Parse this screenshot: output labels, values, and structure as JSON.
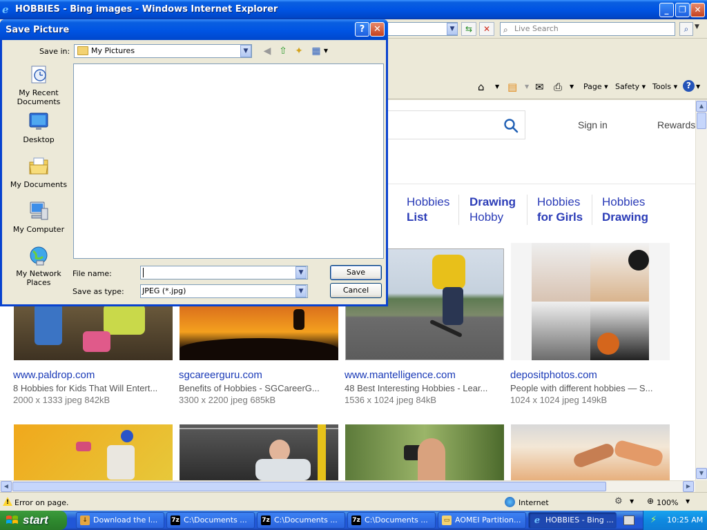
{
  "browser": {
    "title": "HOBBIES - Bing images - Windows Internet Explorer",
    "search_placeholder": "Live Search",
    "cmd": {
      "page": "Page",
      "safety": "Safety",
      "tools": "Tools"
    }
  },
  "bing": {
    "sign_in": "Sign in",
    "rewards": "Rewards",
    "chips": [
      {
        "line1": "Hobbies",
        "line2": "List",
        "bold": "line2"
      },
      {
        "line1": "Drawing",
        "line2": "Hobby",
        "bold": "line1"
      },
      {
        "line1": "Hobbies",
        "line2": "for Girls",
        "bold": "line2"
      },
      {
        "line1": "Hobbies",
        "line2": "Drawing",
        "bold": "line2"
      }
    ],
    "results": [
      {
        "site": "www.paldrop.com",
        "title": "8 Hobbies for Kids That Will Entert...",
        "meta": "2000 x 1333 jpeg 842kB"
      },
      {
        "site": "sgcareerguru.com",
        "title": "Benefits of Hobbies - SGCareerG...",
        "meta": "3300 x 2200 jpeg 685kB"
      },
      {
        "site": "www.mantelligence.com",
        "title": "48 Best Interesting Hobbies - Lear...",
        "meta": "1536 x 1024 jpeg 84kB"
      },
      {
        "site": "depositphotos.com",
        "title": "People with different hobbies — S...",
        "meta": "1024 x 1024 jpeg 149kB"
      }
    ]
  },
  "dialog": {
    "title": "Save Picture",
    "help": "?",
    "close": "✕",
    "save_in_label": "Save in:",
    "save_in_value": "My Pictures",
    "places": [
      "My Recent Documents",
      "Desktop",
      "My Documents",
      "My Computer",
      "My Network Places"
    ],
    "file_name_label": "File name:",
    "file_name_value": "",
    "save_as_label": "Save as type:",
    "save_as_value": "JPEG (*.jpg)",
    "save_button": "Save",
    "cancel_button": "Cancel"
  },
  "statusbar": {
    "message": "Error on page.",
    "zone": "Internet",
    "zoom": "100%"
  },
  "taskbar": {
    "start": "start",
    "tasks": [
      "Download the l...",
      "C:\\Documents ...",
      "C:\\Documents ...",
      "C:\\Documents ...",
      "AOMEI Partition...",
      "HOBBIES - Bing ..."
    ],
    "clock": "10:25 AM"
  }
}
